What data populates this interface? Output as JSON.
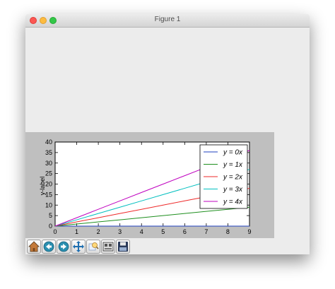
{
  "window": {
    "title": "Figure 1"
  },
  "toolbar": {
    "buttons": [
      {
        "icon": "home-icon"
      },
      {
        "icon": "back-icon"
      },
      {
        "icon": "forward-icon"
      },
      {
        "icon": "pan-icon"
      },
      {
        "icon": "zoom-icon"
      },
      {
        "icon": "subplots-icon"
      },
      {
        "icon": "save-icon"
      }
    ]
  },
  "chart_data": {
    "type": "line",
    "title": "",
    "xlabel": "",
    "ylabel": "y-label",
    "xlim": [
      0,
      9
    ],
    "ylim": [
      0,
      40
    ],
    "xticks": [
      0,
      1,
      2,
      3,
      4,
      5,
      6,
      7,
      8,
      9
    ],
    "yticks": [
      0,
      5,
      10,
      15,
      20,
      25,
      30,
      35,
      40
    ],
    "grid": false,
    "legend_position": "upper-right",
    "x": [
      0,
      1,
      2,
      3,
      4,
      5,
      6,
      7,
      8,
      9
    ],
    "series": [
      {
        "name": "y = 0x",
        "color": "#1f3fbf",
        "values": [
          0,
          0,
          0,
          0,
          0,
          0,
          0,
          0,
          0,
          0
        ]
      },
      {
        "name": "y = 1x",
        "color": "#1f8f1f",
        "values": [
          0,
          1,
          2,
          3,
          4,
          5,
          6,
          7,
          8,
          9
        ]
      },
      {
        "name": "y = 2x",
        "color": "#ee2a2a",
        "values": [
          0,
          2,
          4,
          6,
          8,
          10,
          12,
          14,
          16,
          18
        ]
      },
      {
        "name": "y = 3x",
        "color": "#00bfbf",
        "values": [
          0,
          3,
          6,
          9,
          12,
          15,
          18,
          21,
          24,
          27
        ]
      },
      {
        "name": "y = 4x",
        "color": "#bf00bf",
        "values": [
          0,
          4,
          8,
          12,
          16,
          20,
          24,
          28,
          32,
          36
        ]
      }
    ]
  }
}
